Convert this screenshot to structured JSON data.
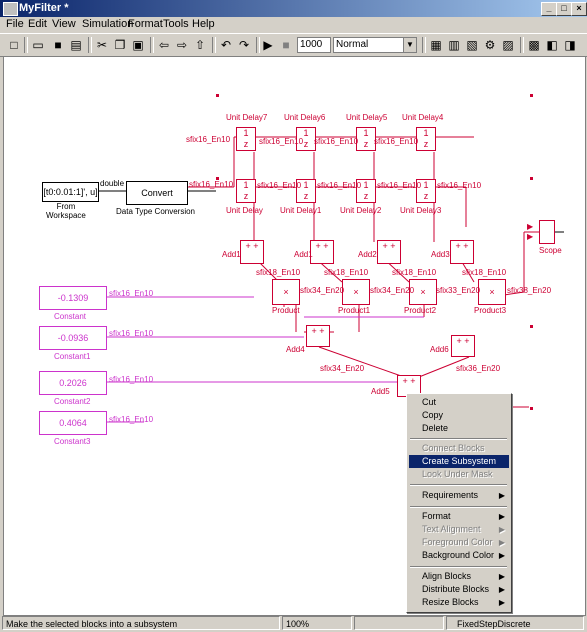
{
  "window": {
    "title": "MyFilter *"
  },
  "menubar": [
    "File",
    "Edit",
    "View",
    "Simulation",
    "Format",
    "Tools",
    "Help"
  ],
  "toolbar": {
    "sim_time": "1000",
    "sim_mode": "Normal"
  },
  "blocks": {
    "from_workspace": {
      "value": "[t0:0.01:1]', u]",
      "label": "From\nWorkspace"
    },
    "dtc": {
      "value": "Convert",
      "label": "Data Type Conversion",
      "in_signal": "double",
      "out_signal": "sfix16_En10"
    },
    "unit_delay_labels": [
      "Unit Delay7",
      "Unit Delay6",
      "Unit Delay5",
      "Unit Delay4"
    ],
    "unit_delay_bottom": [
      "Unit Delay",
      "Unit Delay1",
      "Unit Delay2",
      "Unit Delay3"
    ],
    "add_labels": [
      "Add1",
      "Add1",
      "Add2",
      "Add3"
    ],
    "product_labels": [
      "Product",
      "Product1",
      "Product2",
      "Product3"
    ],
    "add4": "Add4",
    "add5": "Add5",
    "add6": "Add6",
    "scope": "Scope",
    "constants": [
      {
        "value": "-0.1309",
        "label": "Constant"
      },
      {
        "value": "-0.0936",
        "label": "Constant1"
      },
      {
        "value": "0.2026",
        "label": "Constant2"
      },
      {
        "value": "0.4064",
        "label": "Constant3"
      }
    ],
    "signal_sfix16": "sfix16_En10",
    "signal_sfix34": "sfix34_En20",
    "signal_sfix33": "sfix33_En20",
    "signal_sfix38": "sfix38_En20",
    "signal_sfix32": "sfix32_En20",
    "signal_sfix18": "sfix18_En10",
    "signal_sfix34b": "sfix34_En20",
    "signal_sfix36": "sfix36_En20",
    "ud_num": "1",
    "ud_den": "z"
  },
  "context_menu": {
    "items": [
      {
        "label": "Cut",
        "disabled": false
      },
      {
        "label": "Copy",
        "disabled": false
      },
      {
        "label": "Delete",
        "disabled": false
      },
      {
        "label": "Connect Blocks",
        "disabled": true
      },
      {
        "label": "Create Subsystem",
        "selected": true
      },
      {
        "label": "Look Under Mask",
        "disabled": true
      },
      {
        "label": "Requirements",
        "submenu": true
      },
      {
        "label": "Format",
        "submenu": true
      },
      {
        "label": "Text Alignment",
        "disabled": true,
        "submenu": true
      },
      {
        "label": "Foreground Color",
        "disabled": true,
        "submenu": true
      },
      {
        "label": "Background Color",
        "submenu": true
      },
      {
        "label": "Align Blocks",
        "submenu": true
      },
      {
        "label": "Distribute Blocks",
        "submenu": true
      },
      {
        "label": "Resize Blocks",
        "submenu": true
      }
    ]
  },
  "status": {
    "message": "Make the selected blocks into a subsystem",
    "zoom": "100%",
    "solver": "FixedStepDiscrete"
  }
}
